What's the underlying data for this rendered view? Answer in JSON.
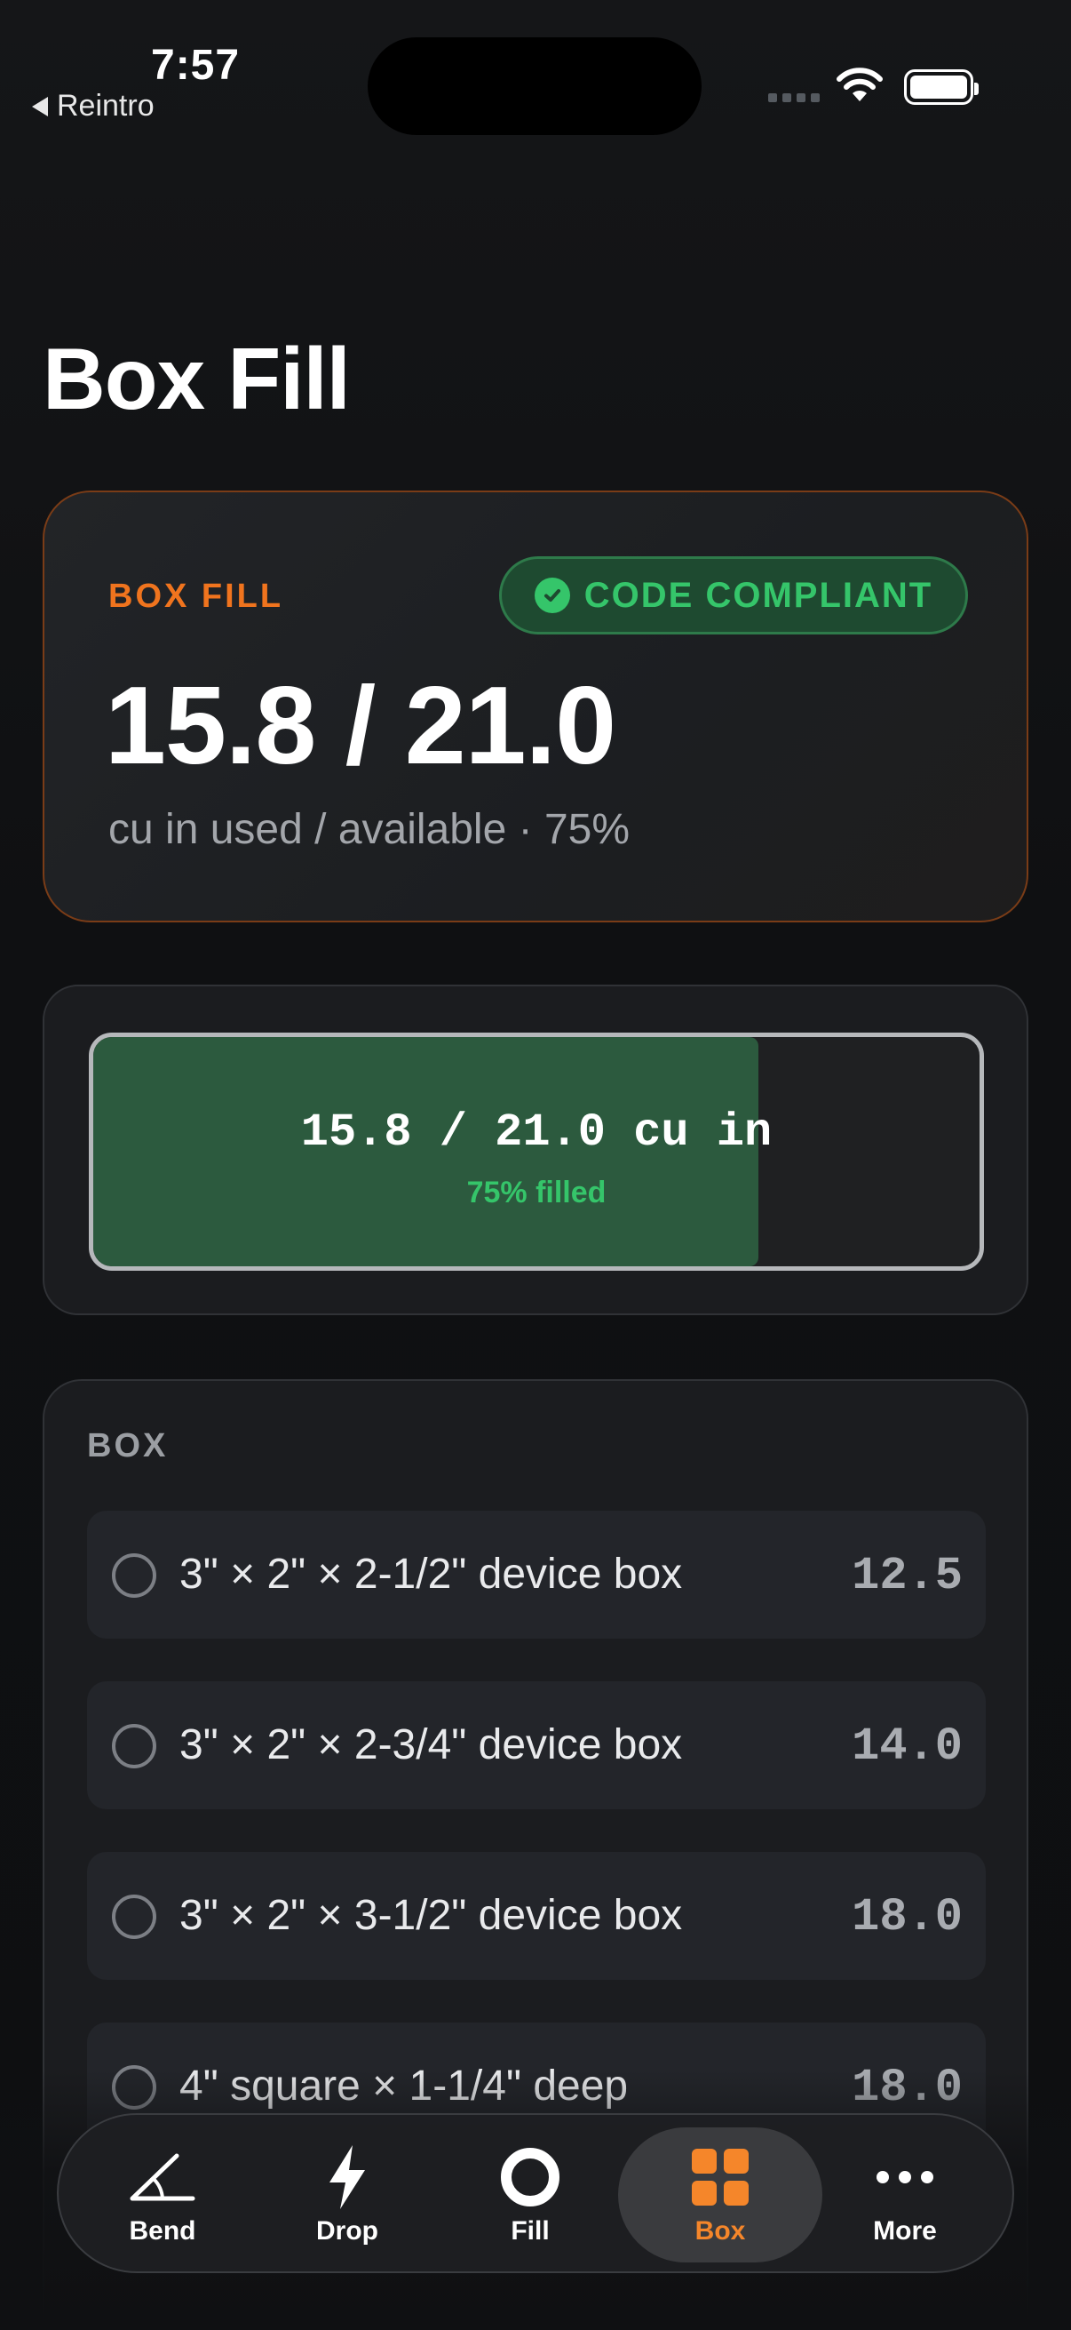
{
  "status_bar": {
    "time": "7:57",
    "back_app": "Reintro"
  },
  "page": {
    "title": "Box Fill"
  },
  "summary": {
    "label": "BOX FILL",
    "badge": "CODE COMPLIANT",
    "value": "15.8 / 21.0",
    "subtitle": "cu in used / available · 75%",
    "accent_color": "#f0741e",
    "badge_color": "#35c56a"
  },
  "fill_bar": {
    "main_text": "15.8 / 21.0 cu in",
    "sub_text": "75% filled",
    "fraction": 0.75
  },
  "box_section": {
    "heading": "BOX",
    "items": [
      {
        "name": "3\" × 2\" × 2-1/2\" device box",
        "volume": "12.5"
      },
      {
        "name": "3\" × 2\" × 2-3/4\" device box",
        "volume": "14.0"
      },
      {
        "name": "3\" × 2\" × 3-1/2\" device box",
        "volume": "18.0"
      },
      {
        "name": "4\" square × 1-1/4\" deep",
        "volume": "18.0"
      }
    ]
  },
  "tab_bar": {
    "tabs": [
      {
        "label": "Bend",
        "icon": "angle-icon"
      },
      {
        "label": "Drop",
        "icon": "bolt-icon"
      },
      {
        "label": "Fill",
        "icon": "ring-icon"
      },
      {
        "label": "Box",
        "icon": "grid-icon",
        "active": true
      },
      {
        "label": "More",
        "icon": "ellipsis-icon"
      }
    ],
    "active_color": "#f5862a"
  }
}
